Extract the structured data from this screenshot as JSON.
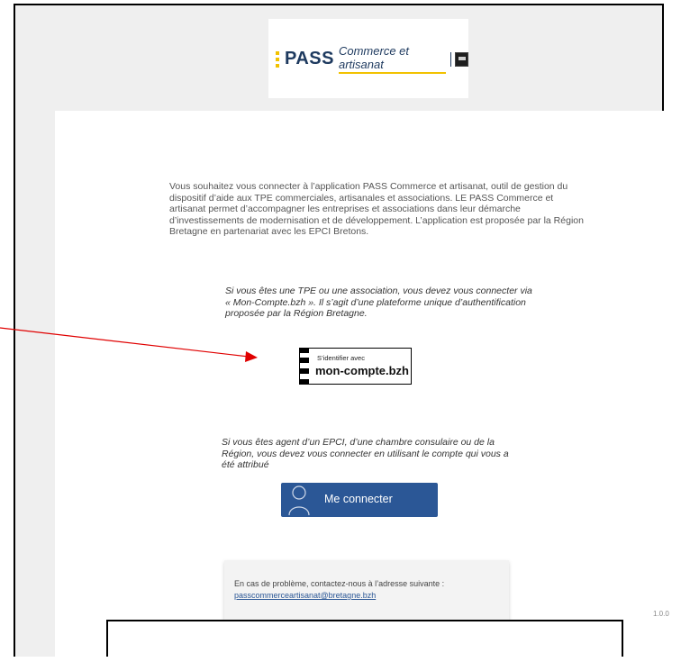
{
  "logo": {
    "brand": "PASS",
    "subtitle": "Commerce et artisanat"
  },
  "intro_text": "Vous souhaitez vous connecter à l’application PASS Commerce et artisanat, outil de gestion du dispositif d’aide aux TPE commerciales, artisanales et associations. LE PASS Commerce et artisanat permet d’accompagner les entreprises et associations dans leur démarche d’investissements de modernisation et de développement. L’application est proposée par la Région Bretagne en partenariat avec les EPCI Bretons.",
  "tpe_section": {
    "text": "Si vous êtes une TPE ou une association, vous devez vous connecter via « Mon-Compte.bzh ». Il s’agit d’une plateforme unique d’authentification proposée par la Région Bretagne.",
    "button_small": "S’identifier avec",
    "button_big": "mon-compte.bzh"
  },
  "agent_section": {
    "text": "Si vous êtes agent d’un EPCI, d’une chambre consulaire ou de la Région, vous devez vous connecter en utilisant le compte qui vous a été attribué",
    "button_label": "Me connecter"
  },
  "help": {
    "text": "En cas de problème, contactez-nous à l’adresse suivante :",
    "email": "passcommerceartisanat@bretagne.bzh"
  },
  "version": "1.0.0",
  "colors": {
    "accent_yellow": "#f2c200",
    "brand_blue": "#1e3a5f",
    "button_blue": "#2b5796",
    "arrow_red": "#e00000"
  },
  "icons": {
    "connect_button": "person-icon",
    "annotation": "red-arrow"
  }
}
